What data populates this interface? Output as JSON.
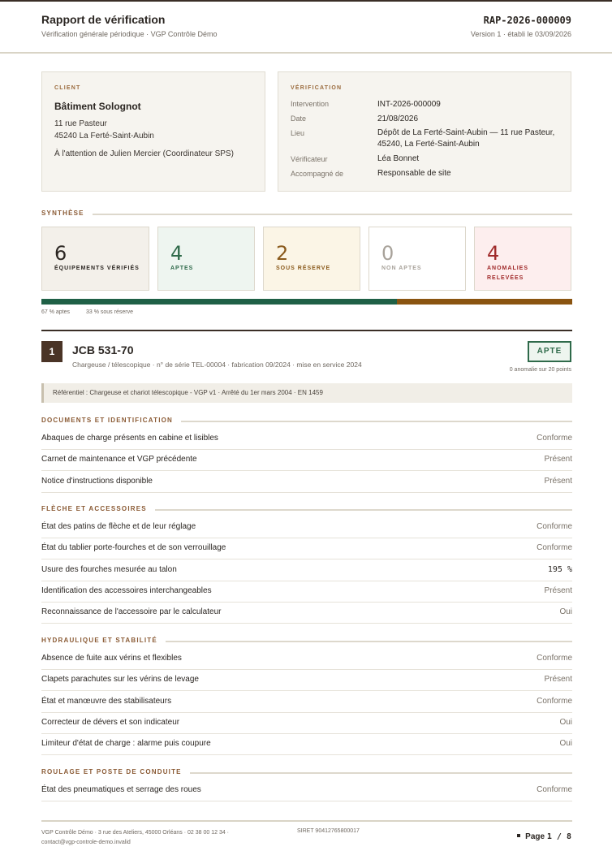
{
  "header": {
    "title": "Rapport de vérification",
    "subtitle": "Vérification générale périodique · VGP Contrôle Démo",
    "report_number": "RAP-2026-000009",
    "version": "Version 1 · établi le 03/09/2026"
  },
  "client": {
    "label": "CLIENT",
    "name": "Bâtiment Solognot",
    "address1": "11 rue Pasteur",
    "address2": "45240 La Ferté-Saint-Aubin",
    "attention": "À l'attention de Julien Mercier (Coordinateur SPS)"
  },
  "verification": {
    "label": "VÉRIFICATION",
    "intervention_key": "Intervention",
    "intervention": "INT-2026-000009",
    "date_key": "Date",
    "date": "21/08/2026",
    "lieu_key": "Lieu",
    "lieu_line1": "Dépôt de La Ferté-Saint-Aubin — 11 rue Pasteur,",
    "lieu_line2": "45240, La Ferté-Saint-Aubin",
    "verificateur_key": "Vérificateur",
    "verificateur": "Léa Bonnet",
    "accompagne_key": "Accompagné de",
    "accompagne": "Responsable de site"
  },
  "synthese": {
    "title": "SYNTHÈSE",
    "cards": [
      {
        "value": "6",
        "label": "ÉQUIPEMENTS VÉRIFIÉS",
        "label2": "",
        "color": "#2b2622",
        "bg": "#f3f0ea"
      },
      {
        "value": "4",
        "label": "APTES",
        "label2": "",
        "color": "#2f6a4a",
        "bg": "#eef5f0"
      },
      {
        "value": "2",
        "label": "SOUS RÉSERVE",
        "label2": "",
        "color": "#8a5a1c",
        "bg": "#fbf5e6"
      },
      {
        "value": "0",
        "label": "NON APTES",
        "label2": "",
        "color": "#a8a29a",
        "bg": "#ffffff"
      },
      {
        "value": "4",
        "label": "ANOMALIES",
        "label2": "RELEVÉES",
        "color": "#a02a2a",
        "bg": "#fdeeee"
      }
    ],
    "aptes_fraction": 0.67,
    "reserve_fraction": 0.33,
    "aptes_caption": "67 % aptes",
    "reserve_caption": "33 % sous réserve",
    "colors": {
      "aptes": "#1f6046",
      "reserve": "#8a5410"
    }
  },
  "equipment": {
    "index": "1",
    "name": "JCB 531-70",
    "meta": "Chargeuse / télescopique · n° de série TEL-00004 · fabrication 09/2024 · mise en service 2024",
    "status": "APTE",
    "anomalies": "0 anomalie sur 20 points",
    "referentiel": "Référentiel : Chargeuse et chariot télescopique - VGP v1 · Arrêté du 1er mars 2004 · EN 1459"
  },
  "sections": [
    {
      "title": "DOCUMENTS ET IDENTIFICATION",
      "rows": [
        {
          "label": "Abaques de charge présents en cabine et lisibles",
          "value": "Conforme"
        },
        {
          "label": "Carnet de maintenance et VGP précédente",
          "value": "Présent"
        },
        {
          "label": "Notice d'instructions disponible",
          "value": "Présent"
        }
      ]
    },
    {
      "title": "FLÈCHE ET ACCESSOIRES",
      "rows": [
        {
          "label": "État des patins de flèche et de leur réglage",
          "value": "Conforme"
        },
        {
          "label": "État du tablier porte-fourches et de son verrouillage",
          "value": "Conforme"
        },
        {
          "label": "Usure des fourches mesurée au talon",
          "value": "195 %"
        },
        {
          "label": "Identification des accessoires interchangeables",
          "value": "Présent"
        },
        {
          "label": "Reconnaissance de l'accessoire par le calculateur",
          "value": "Oui"
        }
      ]
    },
    {
      "title": "HYDRAULIQUE ET STABILITÉ",
      "rows": [
        {
          "label": "Absence de fuite aux vérins et flexibles",
          "value": "Conforme"
        },
        {
          "label": "Clapets parachutes sur les vérins de levage",
          "value": "Présent"
        },
        {
          "label": "État et manœuvre des stabilisateurs",
          "value": "Conforme"
        },
        {
          "label": "Correcteur de dévers et son indicateur",
          "value": "Oui"
        },
        {
          "label": "Limiteur d'état de charge : alarme puis coupure",
          "value": "Oui"
        }
      ]
    },
    {
      "title": "ROULAGE ET POSTE DE CONDUITE",
      "rows": [
        {
          "label": "État des pneumatiques et serrage des roues",
          "value": "Conforme"
        }
      ]
    }
  ],
  "footer": {
    "company_line1": "VGP Contrôle Démo · 3 rue des Ateliers, 45000 Orléans · 02 38 00 12 34 ·",
    "company_line2": "contact@vgp-controle-demo.invalid",
    "siret": "SIRET 90412765800017",
    "page_label": "Page",
    "page_current": "1",
    "page_sep": "/",
    "page_total": "8"
  }
}
